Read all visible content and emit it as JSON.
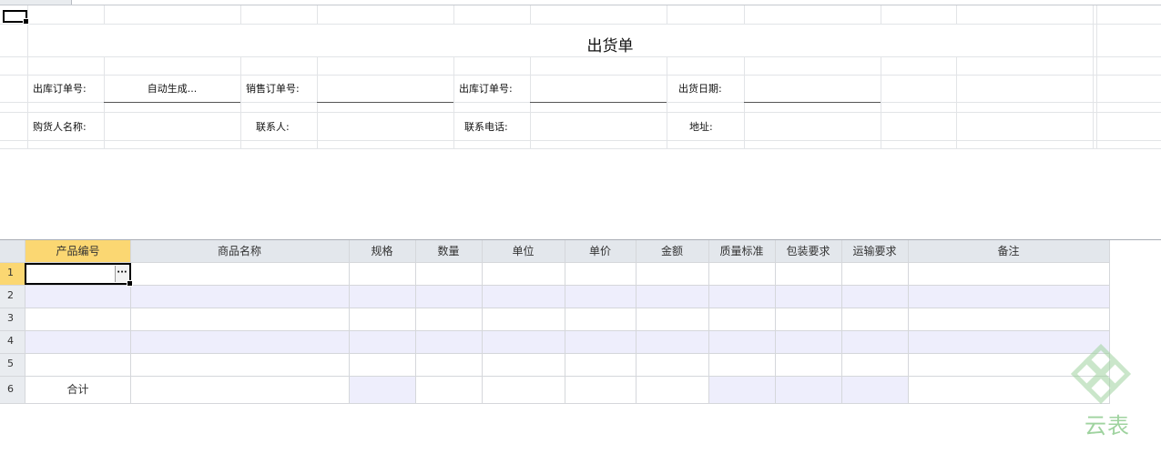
{
  "title": "出货单",
  "form": {
    "row1": [
      {
        "label": "出库订单号:",
        "value": "自动生成..."
      },
      {
        "label": "销售订单号:",
        "value": ""
      },
      {
        "label": "出库订单号:",
        "value": ""
      },
      {
        "label": "出货日期:",
        "value": ""
      }
    ],
    "row2": [
      {
        "label": "购货人名称:",
        "value": ""
      },
      {
        "label": "联系人:",
        "value": ""
      },
      {
        "label": "联系电话:",
        "value": ""
      },
      {
        "label": "地址:",
        "value": ""
      }
    ]
  },
  "grid": {
    "columns": [
      "产品编号",
      "商品名称",
      "规格",
      "数量",
      "单位",
      "单价",
      "金额",
      "质量标准",
      "包装要求",
      "运输要求",
      "备注"
    ],
    "row_numbers": [
      "1",
      "2",
      "3",
      "4",
      "5",
      "6"
    ],
    "total_label": "合计",
    "edit_button": "···"
  },
  "watermark": {
    "text": "云表"
  },
  "colors": {
    "header_bg": "#e3e7ec",
    "active_header_bg": "#fbd772",
    "alt_row_bg": "#eeeefc",
    "grid_line": "#d5d7db"
  }
}
